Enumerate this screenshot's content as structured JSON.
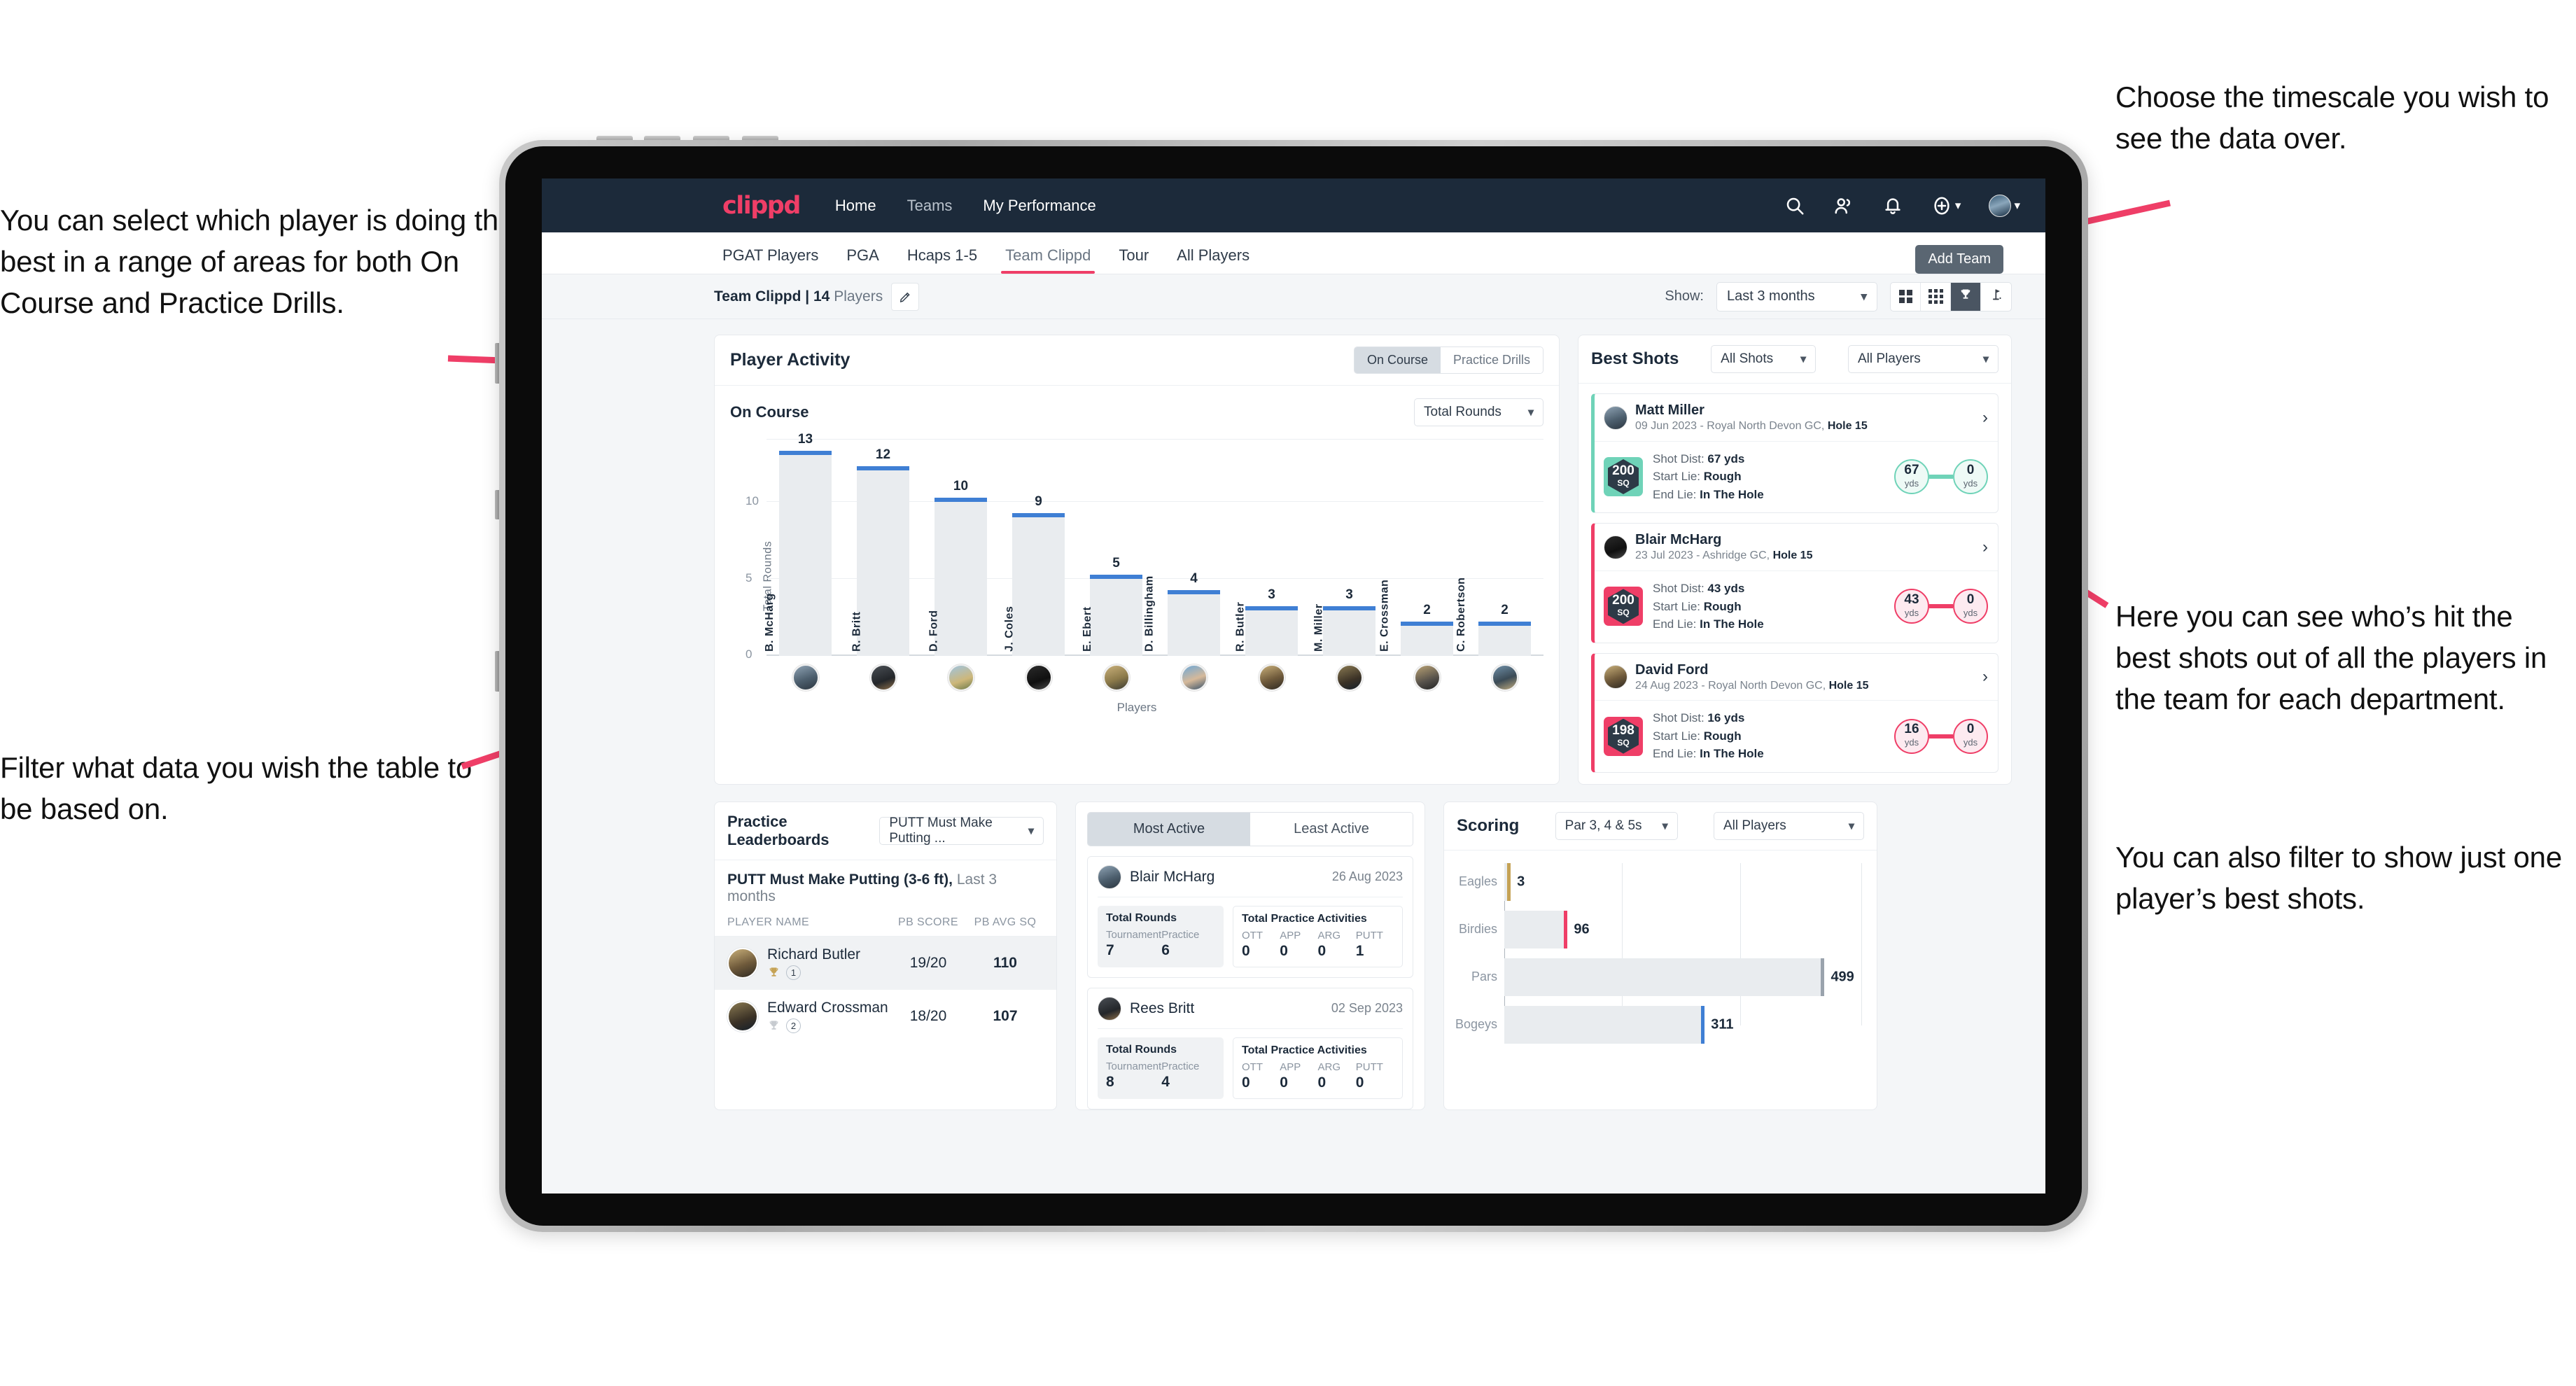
{
  "annotations": {
    "left_top": "You can select which player is doing the best in a range of areas for both On Course and Practice Drills.",
    "left_bottom": "Filter what data you wish the table to be based on.",
    "right_top": "Choose the timescale you wish to see the data over.",
    "right_mid": "Here you can see who’s hit the best shots out of all the players in the team for each department.",
    "right_bottom": "You can also filter to show just one player’s best shots."
  },
  "colors": {
    "brand_pink": "#ef3e67",
    "navbar_dark": "#1c2a3a",
    "bar_blue": "#3f7fd4",
    "teal": "#6fd3b8",
    "gold": "#c5a255"
  },
  "navbar": {
    "brand": "clippd",
    "links": [
      {
        "label": "Home",
        "active": true
      },
      {
        "label": "Teams",
        "active": false
      },
      {
        "label": "My Performance",
        "active": true
      }
    ],
    "icons": [
      "search-icon",
      "people-icon",
      "bell-icon",
      "plus-circle-icon",
      "avatar"
    ]
  },
  "subtabs": {
    "items": [
      {
        "label": "PGAT Players",
        "active": false
      },
      {
        "label": "PGA",
        "active": false
      },
      {
        "label": "Hcaps 1-5",
        "active": false
      },
      {
        "label": "Team Clippd",
        "active": true
      },
      {
        "label": "Tour",
        "active": false
      },
      {
        "label": "All Players",
        "active": false
      }
    ],
    "tooltip": "Add Team"
  },
  "toolbar": {
    "team_name": "Team Clippd",
    "separator": " | ",
    "player_count": "14",
    "players_word": " Players",
    "edit_icon": "pencil-icon",
    "show_label": "Show:",
    "timescale_value": "Last 3 months",
    "view_modes": [
      "grid-2x2-icon",
      "grid-3x3-icon",
      "trophy-icon",
      "flag-icon"
    ],
    "active_view": "trophy-icon"
  },
  "player_activity": {
    "title": "Player Activity",
    "segments": [
      {
        "label": "On Course",
        "active": true
      },
      {
        "label": "Practice Drills",
        "active": false
      }
    ],
    "sub_title": "On Course",
    "metric_select": "Total Rounds"
  },
  "chart_data": [
    {
      "type": "bar",
      "title": "Player Activity — On Course",
      "xlabel": "Players",
      "ylabel": "Total Rounds",
      "categories": [
        "B. McHarg",
        "R. Britt",
        "D. Ford",
        "J. Coles",
        "E. Ebert",
        "D. Billingham",
        "R. Butler",
        "M. Miller",
        "E. Crossman",
        "C. Robertson"
      ],
      "values": [
        13,
        12,
        10,
        9,
        5,
        4,
        3,
        3,
        2,
        2
      ],
      "yticks": [
        0,
        5,
        10
      ],
      "ylim": [
        0,
        14
      ],
      "grid": true,
      "legend": "none"
    },
    {
      "type": "bar",
      "orientation": "horizontal",
      "title": "Scoring",
      "categories": [
        "Eagles",
        "Birdies",
        "Pars",
        "Bogeys"
      ],
      "values": [
        3,
        96,
        499,
        311
      ],
      "xlim": [
        0,
        560
      ],
      "grid": true,
      "legend": "none"
    }
  ],
  "best_shots": {
    "title": "Best Shots",
    "filter_shots": "All Shots",
    "filter_players": "All Players",
    "labels": {
      "shot_dist": "Shot Dist: ",
      "start_lie": "Start Lie: ",
      "end_lie": "End Lie: ",
      "unit": "yds",
      "sq": "SQ"
    },
    "items": [
      {
        "name": "Matt Miller",
        "meta_date": "09 Jun 2023 - Royal North Devon GC, ",
        "meta_hole": "Hole 15",
        "score": "200",
        "shot_dist": "67 yds",
        "start_lie": "Rough",
        "end_lie": "In The Hole",
        "from_val": "67",
        "to_val": "0",
        "accent": "#6fd3b8"
      },
      {
        "name": "Blair McHarg",
        "meta_date": "23 Jul 2023 - Ashridge GC, ",
        "meta_hole": "Hole 15",
        "score": "200",
        "shot_dist": "43 yds",
        "start_lie": "Rough",
        "end_lie": "In The Hole",
        "from_val": "43",
        "to_val": "0",
        "accent": "#ef3e67"
      },
      {
        "name": "David Ford",
        "meta_date": "24 Aug 2023 - Royal North Devon GC, ",
        "meta_hole": "Hole 15",
        "score": "198",
        "shot_dist": "16 yds",
        "start_lie": "Rough",
        "end_lie": "In The Hole",
        "from_val": "16",
        "to_val": "0",
        "accent": "#ef3e67"
      }
    ]
  },
  "practice_leaderboards": {
    "title": "Practice Leaderboards",
    "drill_select": "PUTT Must Make Putting ...",
    "subtitle_bold": "PUTT Must Make Putting (3-6 ft),",
    "subtitle_rest": " Last 3 months",
    "columns": [
      "PLAYER NAME",
      "PB SCORE",
      "PB AVG SQ"
    ],
    "rows": [
      {
        "name": "Richard Butler",
        "rank": "1",
        "score": "19/20",
        "avg_sq": "110",
        "trophy": "gold"
      },
      {
        "name": "Edward Crossman",
        "rank": "2",
        "score": "18/20",
        "avg_sq": "107",
        "trophy": "silver"
      }
    ]
  },
  "activity": {
    "tabs": [
      {
        "label": "Most Active",
        "active": true
      },
      {
        "label": "Least Active",
        "active": false
      }
    ],
    "labels": {
      "total_rounds": "Total Rounds",
      "tournament": "Tournament",
      "practice": "Practice",
      "total_practice": "Total Practice Activities",
      "ott": "OTT",
      "app": "APP",
      "arg": "ARG",
      "putt": "PUTT"
    },
    "items": [
      {
        "name": "Blair McHarg",
        "date": "26 Aug 2023",
        "tournament": "7",
        "practice": "6",
        "ott": "0",
        "app": "0",
        "arg": "0",
        "putt": "1"
      },
      {
        "name": "Rees Britt",
        "date": "02 Sep 2023",
        "tournament": "8",
        "practice": "4",
        "ott": "0",
        "app": "0",
        "arg": "0",
        "putt": "0"
      }
    ]
  },
  "scoring": {
    "title": "Scoring",
    "filter_par": "Par 3, 4 & 5s",
    "filter_players": "All Players",
    "rows": [
      {
        "label": "Eagles",
        "value": "3",
        "cap": "#c5a255"
      },
      {
        "label": "Birdies",
        "value": "96",
        "cap": "#ef3e67"
      },
      {
        "label": "Pars",
        "value": "499",
        "cap": "#9aa3ad"
      },
      {
        "label": "Bogeys",
        "value": "311",
        "cap": "#3f7fd4"
      }
    ]
  }
}
